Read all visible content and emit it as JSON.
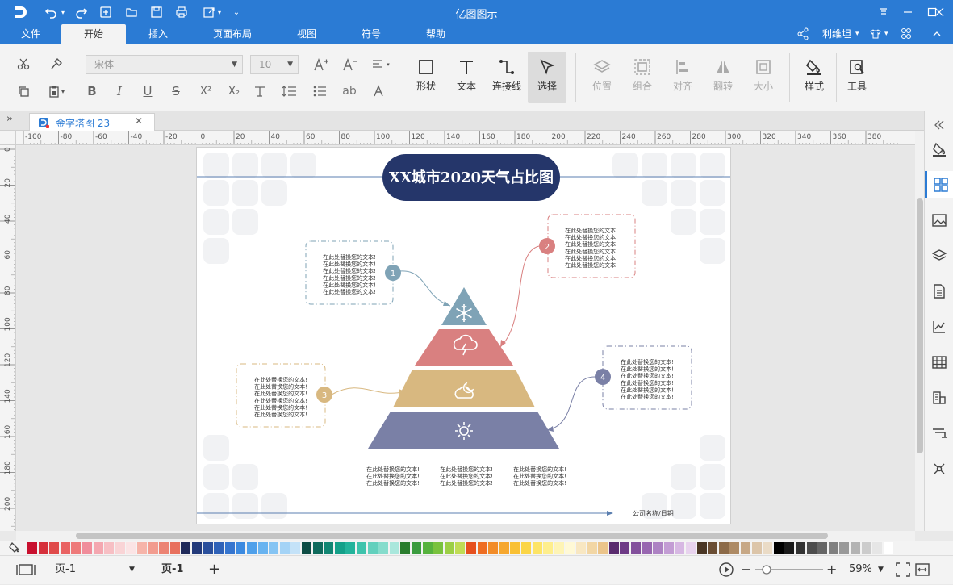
{
  "window": {
    "title": "亿图图示"
  },
  "menu": {
    "tabs": [
      {
        "label": "文件"
      },
      {
        "label": "开始"
      },
      {
        "label": "插入"
      },
      {
        "label": "页面布局"
      },
      {
        "label": "视图"
      },
      {
        "label": "符号"
      },
      {
        "label": "帮助"
      }
    ],
    "active_tab": "开始",
    "user_name": "利维坦"
  },
  "ribbon": {
    "font_family": "宋体",
    "font_size": "10",
    "big_buttons": [
      {
        "label": "形状",
        "icon": "shape-icon"
      },
      {
        "label": "文本",
        "icon": "text-icon"
      },
      {
        "label": "连接线",
        "icon": "connector-icon"
      },
      {
        "label": "选择",
        "icon": "select-icon"
      },
      {
        "label": "位置",
        "icon": "position-icon"
      },
      {
        "label": "组合",
        "icon": "group-icon"
      },
      {
        "label": "对齐",
        "icon": "align-icon"
      },
      {
        "label": "翻转",
        "icon": "flip-icon"
      },
      {
        "label": "大小",
        "icon": "size-icon"
      },
      {
        "label": "样式",
        "icon": "style-icon"
      },
      {
        "label": "工具",
        "icon": "tools-icon"
      }
    ],
    "small_labels": {
      "bold": "B",
      "italic": "I",
      "underline": "U",
      "strike": "S",
      "sup": "X²",
      "sub": "X₂",
      "ab": "ab"
    }
  },
  "document": {
    "tab_name": "金字塔图 23"
  },
  "ruler": {
    "h_ticks": [
      "-100",
      "-80",
      "-60",
      "-40",
      "-20",
      "0",
      "20",
      "40",
      "60",
      "80",
      "100",
      "120",
      "140",
      "160",
      "180",
      "200",
      "220",
      "240",
      "260",
      "280",
      "300",
      "320",
      "340",
      "360",
      "380"
    ],
    "v_ticks": [
      "0",
      "20",
      "40",
      "60",
      "80",
      "100",
      "120",
      "140",
      "160",
      "180",
      "200"
    ]
  },
  "diagram": {
    "title": "XX城市2020天气占比图",
    "placeholder": "在此处替换您的文本!",
    "badges": [
      "1",
      "2",
      "3",
      "4"
    ],
    "footer": "公司名称/日期",
    "colors": {
      "title_bg": "#25366a",
      "level1": "#7fa3b6",
      "level2": "#d98080",
      "level3": "#d8b880",
      "level4": "#7a80a6"
    }
  },
  "status": {
    "page_select": "页-1",
    "page_tab": "页-1",
    "add_page": "+",
    "zoom": "59%"
  }
}
